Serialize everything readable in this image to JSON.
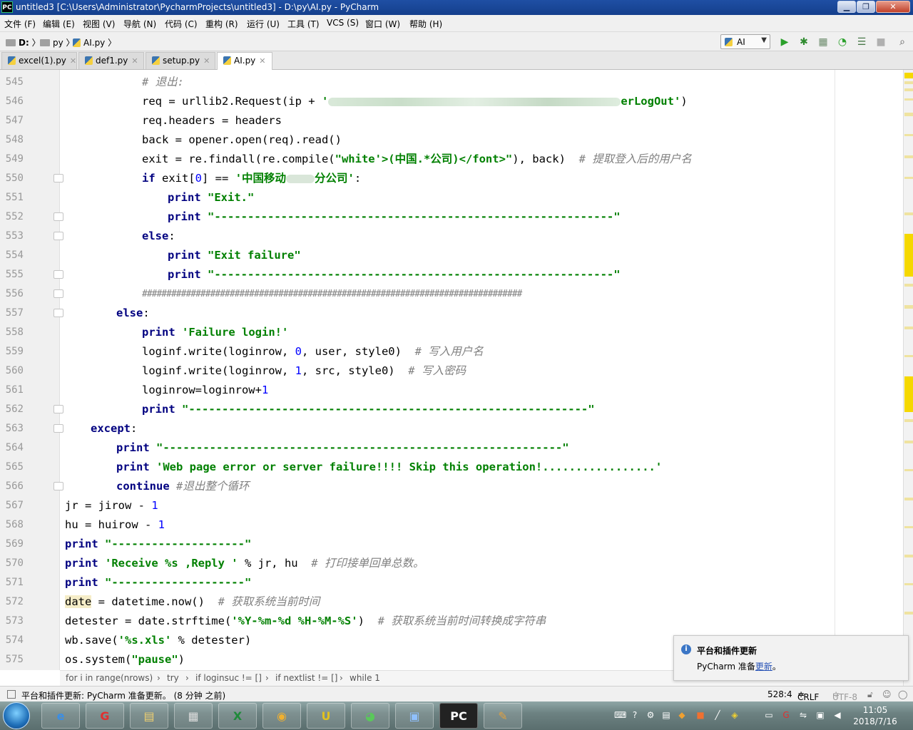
{
  "window": {
    "title": "untitled3 [C:\\Users\\Administrator\\PycharmProjects\\untitled3] - D:\\py\\AI.py - PyCharm",
    "app_icon_text": "PC"
  },
  "menu": [
    "文件 (F)",
    "编辑 (E)",
    "视图 (V)",
    "导航 (N)",
    "代码 (C)",
    "重构 (R)",
    "运行 (U)",
    "工具 (T)",
    "VCS (S)",
    "窗口 (W)",
    "帮助 (H)"
  ],
  "nav": {
    "drive": "D:",
    "folder": "py",
    "file": "AI.py",
    "run_config": "AI"
  },
  "tabs": [
    "excel(1).py",
    "def1.py",
    "setup.py",
    "AI.py"
  ],
  "active_tab": "AI.py",
  "editor": {
    "line_numbers": [
      "545",
      "546",
      "547",
      "548",
      "549",
      "550",
      "551",
      "552",
      "553",
      "554",
      "555",
      "556",
      "557",
      "558",
      "559",
      "560",
      "561",
      "562",
      "563",
      "564",
      "565",
      "566",
      "567",
      "568",
      "569",
      "570",
      "571",
      "572",
      "573",
      "574",
      "575"
    ],
    "code": {
      "l545_c": "# 退出:",
      "l546_a": "req = urllib2.Request(ip + ",
      "l546_s1": "'",
      "l546_s2": "erLogOut'",
      "l546_b": ")",
      "l547": "req.headers = headers",
      "l548": "back = opener.open(req).read()",
      "l549_a": "exit = re.findall(re.compile(",
      "l549_s": "\"white'>(中国.*公司)</font>\"",
      "l549_b": "), back)  ",
      "l549_c": "# 提取登入后的用户名",
      "l550_k": "if ",
      "l550_a": "exit[",
      "l550_n": "0",
      "l550_b": "] == ",
      "l550_s1": "'中国移动",
      "l550_s2": "分公司'",
      "l550_c": ":",
      "l551_k": "print ",
      "l551_s": "\"Exit.\"",
      "l552_k": "print ",
      "l552_s": "\"------------------------------------------------------------\"",
      "l553_k": "else",
      "l553_c": ":",
      "l554_k": "print ",
      "l554_s": "\"Exit failure\"",
      "l555_k": "print ",
      "l555_s": "\"------------------------------------------------------------\"",
      "l556_c": "##############################################################################",
      "l557_k": "else",
      "l557_c": ":",
      "l558_k": "print ",
      "l558_s": "'Failure login!'",
      "l559_a": "loginf.write(loginrow, ",
      "l559_n": "0",
      "l559_b": ", user, style0)  ",
      "l559_c": "# 写入用户名",
      "l560_a": "loginf.write(loginrow, ",
      "l560_n": "1",
      "l560_b": ", src, style0)  ",
      "l560_c": "# 写入密码",
      "l561_a": "loginrow=loginrow+",
      "l561_n": "1",
      "l562_k": "print ",
      "l562_s": "\"------------------------------------------------------------\"",
      "l563_k": "except",
      "l563_c": ":",
      "l564_k": "print ",
      "l564_s": "\"------------------------------------------------------------\"",
      "l565_k": "print ",
      "l565_s": "'Web page error or server failure!!!! Skip this operation!.................'",
      "l566_k": "continue ",
      "l566_c": "#退出整个循环",
      "l567_a": "jr = jirow - ",
      "l567_n": "1",
      "l568_a": "hu = huirow - ",
      "l568_n": "1",
      "l569_k": "print ",
      "l569_s": "\"--------------------\"",
      "l570_k": "print ",
      "l570_s": "'Receive %s ,Reply '",
      "l570_a": " % jr, hu  ",
      "l570_c": "# 打印接单回单总数。",
      "l571_k": "print ",
      "l571_s": "\"--------------------\"",
      "l572_h": "date",
      "l572_a": " = datetime.now()  ",
      "l572_c": "# 获取系统当前时间",
      "l573_a": "detester = date.strftime(",
      "l573_s": "'%Y-%m-%d %H-%M-%S'",
      "l573_b": ")  ",
      "l573_c": "# 获取系统当前时间转换成字符串",
      "l574_a": "wb.save(",
      "l574_s": "'%s.xls'",
      "l574_b": " % detester)",
      "l575_a": "os.system(",
      "l575_s": "\"pause\"",
      "l575_b": ")"
    }
  },
  "breadcrumbs": [
    "for i in range(nrows)",
    "try",
    "if loginsuc != []",
    "if nextlist != []",
    "while 1"
  ],
  "notification": {
    "title": "平台和插件更新",
    "text_prefix": "PyCharm 准备",
    "link": "更新",
    "text_suffix": "。"
  },
  "status": {
    "message": "平台和插件更新: PyCharm 准备更新。 (8 分钟 之前)",
    "position": "528:4",
    "line_sep": "CRLF",
    "encoding": "UTF-8"
  },
  "taskbar": {
    "time": "11:05",
    "date": "2018/7/16"
  },
  "colors": {
    "keyword": "#000080",
    "string": "#008000",
    "number": "#0000ff",
    "comment": "#808080",
    "scroll_marker": "#f5d800"
  }
}
